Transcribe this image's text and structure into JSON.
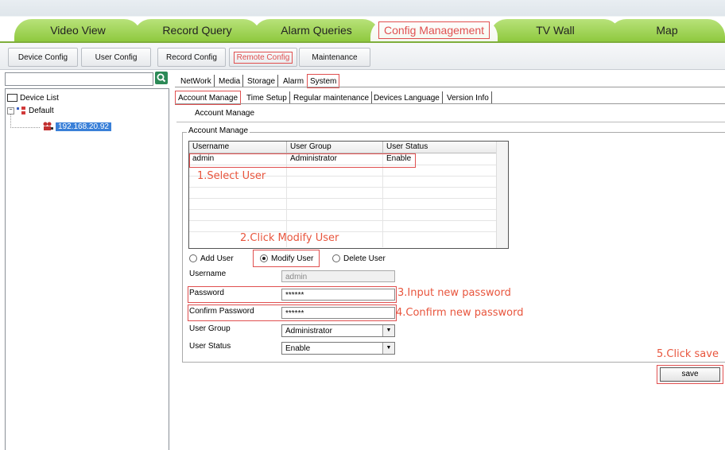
{
  "main_tabs": [
    {
      "label": "Video View"
    },
    {
      "label": "Record Query"
    },
    {
      "label": "Alarm Queries"
    },
    {
      "label": "Config Management"
    },
    {
      "label": "TV Wall"
    },
    {
      "label": "Map"
    }
  ],
  "sub_tabs": [
    {
      "label": "Device Config"
    },
    {
      "label": "User Config"
    },
    {
      "label": "Record Config"
    },
    {
      "label": "Remote Config"
    },
    {
      "label": "Maintenance"
    }
  ],
  "tree": {
    "root": "Device List",
    "group": "Default",
    "device": "192.168.20.92"
  },
  "config_tabs": [
    "NetWork",
    "Media",
    "Storage",
    "Alarm",
    "System"
  ],
  "system_tabs": [
    "Account Manage",
    "Time Setup",
    "Regular maintenance",
    "Devices Language",
    "Version Info"
  ],
  "account": {
    "heading": "Account Manage",
    "fieldset_title": "Account Manage",
    "columns": [
      "Username",
      "User Group",
      "User Status"
    ],
    "rows": [
      {
        "username": "admin",
        "group": "Administrator",
        "status": "Enable"
      }
    ],
    "radios": [
      "Add User",
      "Modify User",
      "Delete User"
    ],
    "labels": {
      "username": "Username",
      "password": "Password",
      "confirm": "Confirm Password",
      "group": "User Group",
      "status": "User Status"
    },
    "values": {
      "username": "admin",
      "password": "******",
      "confirm": "******",
      "group": "Administrator",
      "status": "Enable"
    },
    "save_label": "save"
  },
  "annotations": {
    "step1": "1.Select User",
    "step2": "2.Click Modify User",
    "step3": "3.Input new password",
    "step4": "4.Confirm new password",
    "step5": "5.Click save"
  },
  "colors": {
    "tab_green": "#8fc93f",
    "highlight_red": "#e05050",
    "selection_blue": "#3a80d8"
  },
  "icons": {
    "search": "search-icon",
    "device_list": "device-list-icon",
    "group": "group-icon",
    "camera": "camera-icon"
  }
}
